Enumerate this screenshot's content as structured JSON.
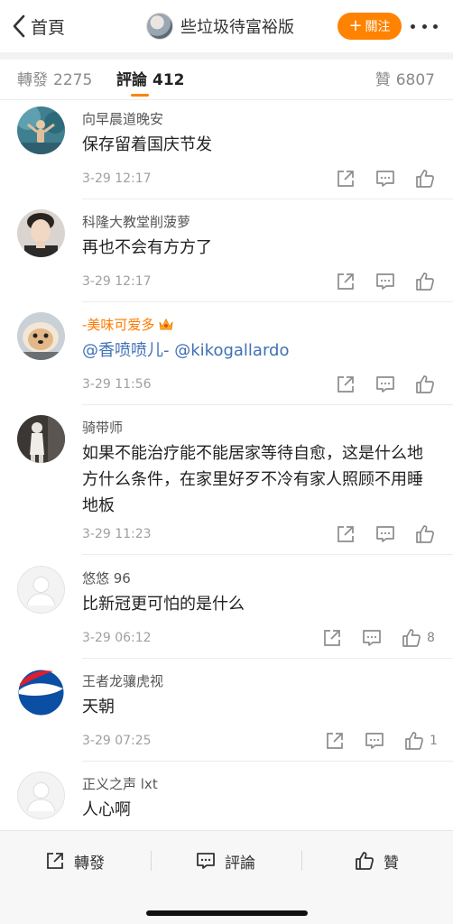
{
  "nav": {
    "back_label": "首頁",
    "title": "些垃圾待富裕版",
    "follow_label": "關注",
    "accent": "#ff8200"
  },
  "tabs": {
    "reposts_label": "轉發",
    "reposts_count": "2275",
    "comments_label": "評論",
    "comments_count": "412",
    "likes_label": "贊",
    "likes_count": "6807"
  },
  "comments": [
    {
      "user": "向早晨道晚安",
      "text": "保存留着国庆节发",
      "time": "3-29 12:17",
      "likes": ""
    },
    {
      "user": "科隆大教堂削菠萝",
      "text": "再也不会有方方了",
      "time": "3-29 12:17",
      "likes": ""
    },
    {
      "user": "-美味可爱多",
      "mention1": "@香喷喷儿-",
      "mention2": "@kikogallardo",
      "time": "3-29 11:56",
      "likes": ""
    },
    {
      "user": "骑带师",
      "text": "如果不能治疗能不能居家等待自愈，这是什么地方什么条件，在家里好歹不冷有家人照顾不用睡地板",
      "time": "3-29 11:23",
      "likes": ""
    },
    {
      "user": "悠悠 96",
      "text": "比新冠更可怕的是什么",
      "time": "3-29 06:12",
      "likes": "8"
    },
    {
      "user": "王者龙骧虎视",
      "text": "天朝",
      "time": "3-29 07:25",
      "likes": "1"
    },
    {
      "user": "正义之声 lxt",
      "text": "人心啊",
      "time": "",
      "likes": ""
    }
  ],
  "bottom_bar": {
    "repost_label": "轉發",
    "comment_label": "評論",
    "like_label": "贊"
  }
}
